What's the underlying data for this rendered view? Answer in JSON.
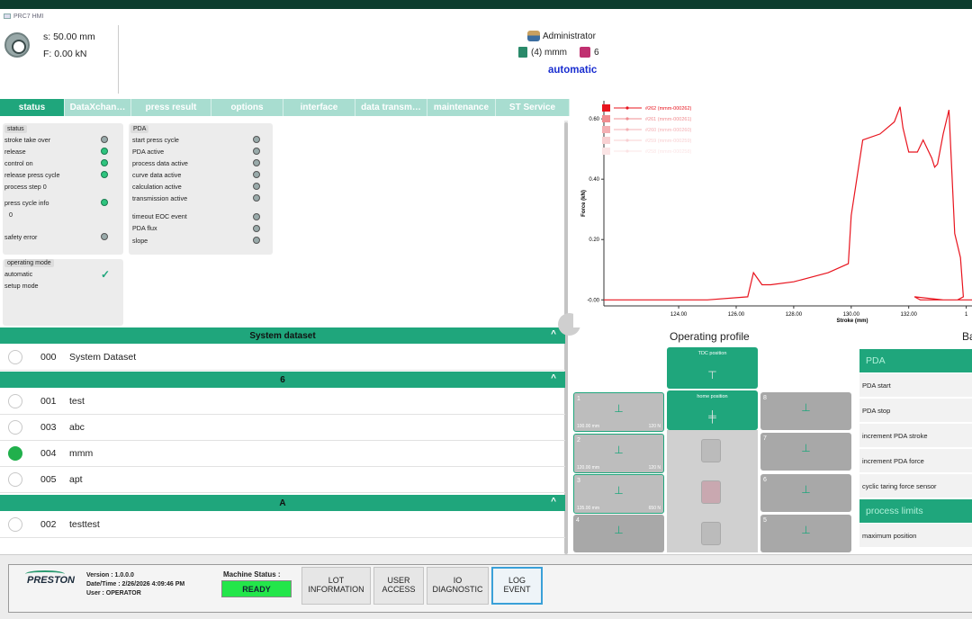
{
  "window": {
    "title": "PRC7 HMI"
  },
  "header": {
    "stroke": "s: 50.00 mm",
    "force": "F: 0.00 kN",
    "user": "Administrator",
    "dataset": "(4) mmm",
    "lot_count": "6",
    "mode": "automatic"
  },
  "tabs": [
    "status",
    "DataXchan…",
    "press result",
    "options",
    "interface",
    "data transm…",
    "maintenance",
    "ST Service"
  ],
  "status_panel": {
    "title": "status",
    "rows": [
      "stroke take over",
      "release",
      "control on",
      "release press cycle",
      "process step  0",
      "press cycle info",
      "0",
      "safety error"
    ]
  },
  "pda_panel": {
    "title": "PDA",
    "rows": [
      "start press cycle",
      "PDA active",
      "process data active",
      "curve data active",
      "calculation active",
      "transmission active",
      "timeout EOC event",
      "PDA flux",
      "slope"
    ]
  },
  "mode_panel": {
    "title": "operating mode",
    "rows": [
      "automatic",
      "setup mode"
    ]
  },
  "datasets": {
    "groups": [
      {
        "title": "System dataset",
        "items": [
          {
            "num": "000",
            "name": "System Dataset",
            "selected": false
          }
        ]
      },
      {
        "title": "6",
        "items": [
          {
            "num": "001",
            "name": "test",
            "selected": false
          },
          {
            "num": "003",
            "name": "abc",
            "selected": false
          },
          {
            "num": "004",
            "name": "mmm",
            "selected": true
          },
          {
            "num": "005",
            "name": "apt",
            "selected": false
          }
        ]
      },
      {
        "title": "A",
        "items": [
          {
            "num": "002",
            "name": "testtest",
            "selected": false
          }
        ]
      }
    ]
  },
  "chart_data": {
    "type": "line",
    "xlabel": "Stroke (mm)",
    "ylabel": "Force (kN)",
    "xlim": [
      121.4,
      134.2
    ],
    "ylim": [
      -0.02,
      0.66
    ],
    "x_ticks": [
      "124.00",
      "126.00",
      "128.00",
      "130.00",
      "132.00",
      "1"
    ],
    "y_ticks": [
      "0.60",
      "0.40",
      "0.20",
      "-0.00"
    ],
    "legend_position": "top-left",
    "series": [
      {
        "name": "#262 (mmm-000262)",
        "color": "#e8141e",
        "x": [
          121.4,
          125.0,
          126.4,
          126.6,
          126.9,
          127.2,
          128.0,
          129.2,
          129.9,
          130.0,
          130.4,
          131.0,
          131.5,
          131.7,
          131.8,
          132.0,
          132.3,
          132.5,
          132.8,
          132.9,
          133.0,
          133.2,
          133.4,
          133.6,
          133.8,
          133.9,
          133.7,
          133.4,
          132.9,
          132.4,
          132.2,
          133.2,
          134.2
        ],
        "y": [
          0.0,
          0.0,
          0.01,
          0.09,
          0.05,
          0.05,
          0.06,
          0.09,
          0.12,
          0.28,
          0.53,
          0.55,
          0.59,
          0.64,
          0.57,
          0.49,
          0.49,
          0.53,
          0.47,
          0.44,
          0.45,
          0.55,
          0.63,
          0.22,
          0.14,
          0.01,
          0.0,
          0.0,
          0.0,
          0.0,
          0.01,
          0.0,
          0.0
        ]
      },
      {
        "name": "#261 (mmm-000261)",
        "color": "#f08c90"
      },
      {
        "name": "#260 (mmm-000260)",
        "color": "#f4b0b4"
      },
      {
        "name": "#259 (mmm-000259)",
        "color": "#f8d0d2"
      },
      {
        "name": "#258 (mmm-000258)",
        "color": "#fbe4e5"
      }
    ]
  },
  "operating_profile": {
    "title": "Operating profile",
    "tdc_label": "TDC position",
    "home_label": "home position",
    "left_boxes": [
      {
        "num": "1",
        "pos": "100.00 mm",
        "force": "120 N"
      },
      {
        "num": "2",
        "pos": "120.00 mm",
        "force": "120 N"
      },
      {
        "num": "3",
        "pos": "135.00 mm",
        "force": "650 N"
      },
      {
        "num": "4",
        "pos": "",
        "force": ""
      }
    ],
    "right_boxes": [
      {
        "num": "8"
      },
      {
        "num": "7"
      },
      {
        "num": "6"
      },
      {
        "num": "5"
      }
    ]
  },
  "params_panel": {
    "title_partial": "Ba",
    "group1": "PDA",
    "rows1": [
      "PDA start",
      "PDA stop",
      "increment PDA stroke",
      "increment PDA force",
      "cyclic taring force sensor"
    ],
    "group2": "process limits",
    "rows2": [
      "maximum position"
    ]
  },
  "footer": {
    "logo": "PRESTON",
    "version": "Version :   1.0.0.0",
    "datetime": "Date/Time : 2/26/2026 4:09:46 PM",
    "user": "User :    OPERATOR",
    "machine_status_label": "Machine Status :",
    "machine_status": "READY",
    "buttons": [
      "LOT\nINFORMATION",
      "USER\nACCESS",
      "IO\nDIAGNOSTIC",
      "LOG\nEVENT"
    ]
  },
  "colors": {
    "accent": "#1fa67c",
    "mode_text": "#1a2ed0",
    "ready": "#23e64a",
    "curve": "#e8141e"
  }
}
